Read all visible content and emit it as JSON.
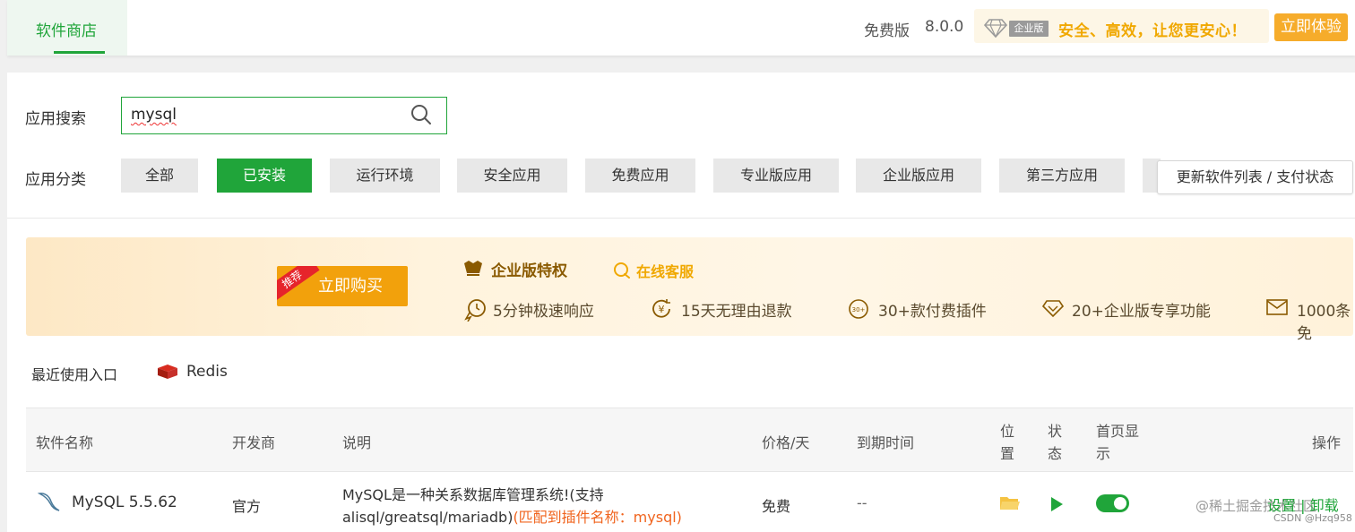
{
  "topbar": {
    "tab": "软件商店",
    "edition": "免费版",
    "version": "8.0.0",
    "enterprise_badge": "企业版",
    "slogan": "安全、高效，让您更安心！",
    "trial_button": "立即体验"
  },
  "search": {
    "label": "应用搜索",
    "value": "mysql"
  },
  "categories": {
    "label": "应用分类",
    "items": [
      "全部",
      "已安装",
      "运行环境",
      "安全应用",
      "免费应用",
      "专业版应用",
      "企业版应用",
      "第三方应用"
    ],
    "active": "已安装",
    "refresh_button": "更新软件列表 / 支付状态"
  },
  "banner": {
    "ribbon": "推荐",
    "buy_button": "立即购买",
    "title": "企业版特权",
    "online_service": "在线客服",
    "features": [
      "5分钟极速响应",
      "15天无理由退款",
      "30+款付费插件",
      "20+企业版专享功能",
      "1000条免"
    ],
    "plugin_icon_text": "30+"
  },
  "recent": {
    "label": "最近使用入口",
    "items": [
      "Redis"
    ]
  },
  "table": {
    "headers": {
      "name": "软件名称",
      "developer": "开发商",
      "desc": "说明",
      "price": "价格/天",
      "expire": "到期时间",
      "location": [
        "位",
        "置"
      ],
      "status": [
        "状",
        "态"
      ],
      "homepage": [
        "首页显",
        "示"
      ],
      "ops": "操作"
    },
    "rows": [
      {
        "name": "MySQL 5.5.62",
        "developer": "官方",
        "desc_line1": "MySQL是一种关系数据库管理系统!(支持",
        "desc_line2": "alisql/greatsql/mariadb)",
        "desc_hint": "(匹配到插件名称：mysql)",
        "price": "免费",
        "expire": "--",
        "homepage_on": true,
        "ops": "设置 | 卸载"
      }
    ]
  },
  "watermark": {
    "line1": "@稀土掘金技术社区",
    "line2": "CSDN @Hzq958"
  },
  "colors": {
    "brand_green": "#20a53a",
    "gold": "#f0a800",
    "orange_hint": "#f0641e"
  }
}
